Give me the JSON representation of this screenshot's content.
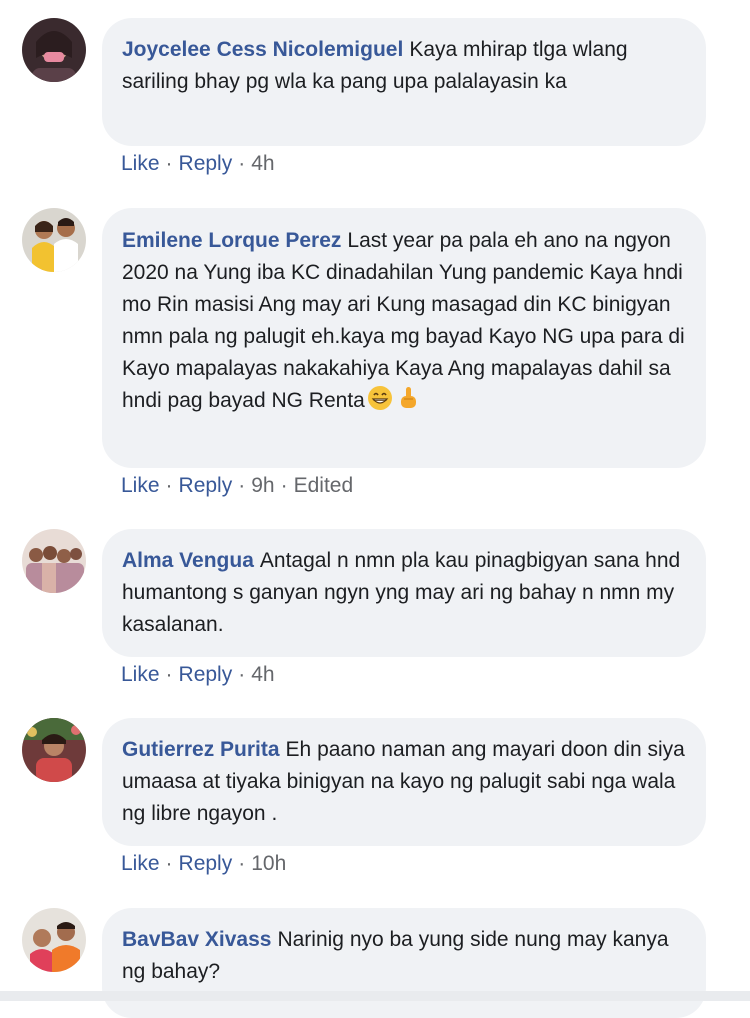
{
  "comments": [
    {
      "author": "Joycelee Cess Nicolemiguel",
      "text": "Kaya mhirap tlga wlang sariling bhay pg wla ka pang upa palalayasin ka",
      "like": "Like",
      "reply": "Reply",
      "time": "4h"
    },
    {
      "author": "Emilene Lorque Perez",
      "text": "Last year pa pala eh ano na ngyon 2020 na Yung iba KC dinadahilan Yung pandemic Kaya hndi mo Rin masisi Ang may ari Kung masagad din KC binigyan nmn pala ng palugit eh.kaya mg bayad Kayo NG upa para di Kayo mapalayas nakakahiya Kaya Ang mapalayas dahil sa hndi pag bayad NG Renta",
      "like": "Like",
      "reply": "Reply",
      "time": "9h",
      "edited": "Edited",
      "emojis": [
        "grinning-face-emoji",
        "pointing-finger-emoji"
      ]
    },
    {
      "author": "Alma Vengua",
      "text": "Antagal n nmn pla kau pinagbigyan sana hnd humantong s ganyan ngyn yng may ari ng bahay n nmn my kasalanan.",
      "like": "Like",
      "reply": "Reply",
      "time": "4h"
    },
    {
      "author": "Gutierrez Purita",
      "text": "Eh paano naman ang mayari doon din siya umaasa at tiyaka binigyan na kayo ng palugit sabi nga wala ng libre ngayon .",
      "like": "Like",
      "reply": "Reply",
      "time": "10h"
    },
    {
      "author": "BavBav Xivass",
      "text": "Narinig nyo ba yung side nung may kanya ng bahay?"
    }
  ],
  "separator": "·",
  "colors": {
    "author": "#385898",
    "bubble": "#f0f2f5",
    "meta": "#65676b"
  }
}
